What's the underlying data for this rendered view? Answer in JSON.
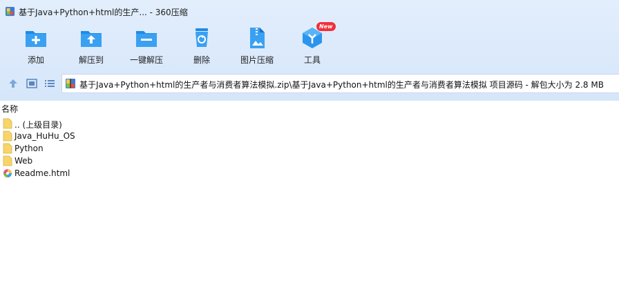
{
  "window": {
    "title": "基于Java+Python+html的生产... - 360压缩",
    "app_icon": "archive-icon"
  },
  "toolbar": {
    "items": [
      {
        "label": "添加",
        "icon": "add-folder-icon"
      },
      {
        "label": "解压到",
        "icon": "extract-folder-icon"
      },
      {
        "label": "一键解压",
        "icon": "quick-extract-icon"
      },
      {
        "label": "删除",
        "icon": "trash-icon"
      },
      {
        "label": "图片压缩",
        "icon": "image-compress-icon"
      },
      {
        "label": "工具",
        "icon": "tools-cube-icon",
        "badge": "New"
      }
    ]
  },
  "nav": {
    "up_icon": "arrow-up-icon",
    "view_icon": "thumbnail-view-icon",
    "list_icon": "list-view-icon",
    "path": "基于Java+Python+html的生产者与消费者算法模拟.zip\\基于Java+Python+html的生产者与消费者算法模拟 项目源码 - 解包大小为 2.8 MB"
  },
  "list": {
    "column_name": "名称",
    "rows": [
      {
        "name": ".. (上级目录)",
        "type": "folder"
      },
      {
        "name": "Java_HuHu_OS",
        "type": "folder"
      },
      {
        "name": "Python",
        "type": "folder"
      },
      {
        "name": "Web",
        "type": "folder"
      },
      {
        "name": "Readme.html",
        "type": "html"
      }
    ]
  },
  "colors": {
    "accent": "#1e8be8",
    "toolbar_bg": "#dbe9fb",
    "badge": "#f0303a",
    "folder": "#f7d56b"
  }
}
